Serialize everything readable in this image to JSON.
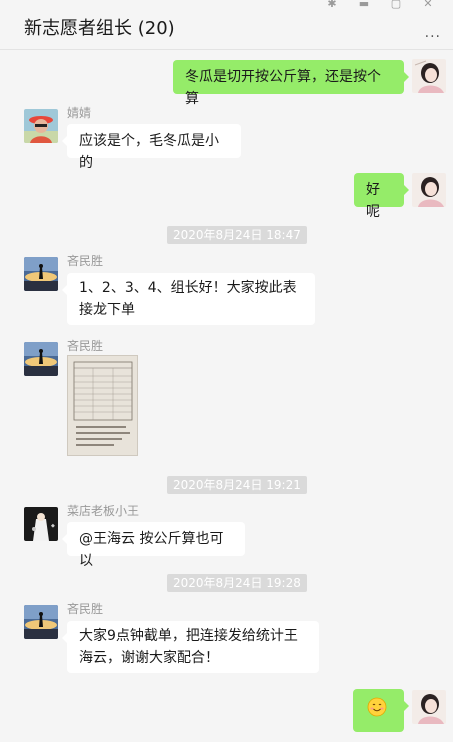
{
  "header": {
    "title": "新志愿者组长 (20)",
    "more_icon": "···"
  },
  "messages": [
    {
      "side": "right",
      "text": "冬瓜是切开按公斤算，还是按个算"
    },
    {
      "side": "left",
      "sender": "婧婧",
      "text": "应该是个，毛冬瓜是小的"
    },
    {
      "side": "right",
      "text": "好呢"
    },
    {
      "time": "2020年8月24日 18:47"
    },
    {
      "side": "left",
      "sender": "吝民胜",
      "text": "1、2、3、4、组长好！大家按此表接龙下单"
    },
    {
      "side": "left",
      "sender": "吝民胜",
      "type": "image",
      "image_icon": "document-photo-icon"
    },
    {
      "time": "2020年8月24日 19:21"
    },
    {
      "side": "left",
      "sender": "菜店老板小王",
      "text": "@王海云 按公斤算也可以"
    },
    {
      "time": "2020年8月24日 19:28"
    },
    {
      "side": "left",
      "sender": "吝民胜",
      "text": "大家9点钟截单，把连接发给统计王海云，谢谢大家配合！"
    },
    {
      "side": "right",
      "type": "emoji",
      "emoji_icon": "smile-emoji-icon"
    }
  ],
  "colors": {
    "self_bubble": "#95ec69",
    "other_bubble": "#ffffff",
    "background": "#f5f5f5",
    "time_badge": "#dadada"
  }
}
